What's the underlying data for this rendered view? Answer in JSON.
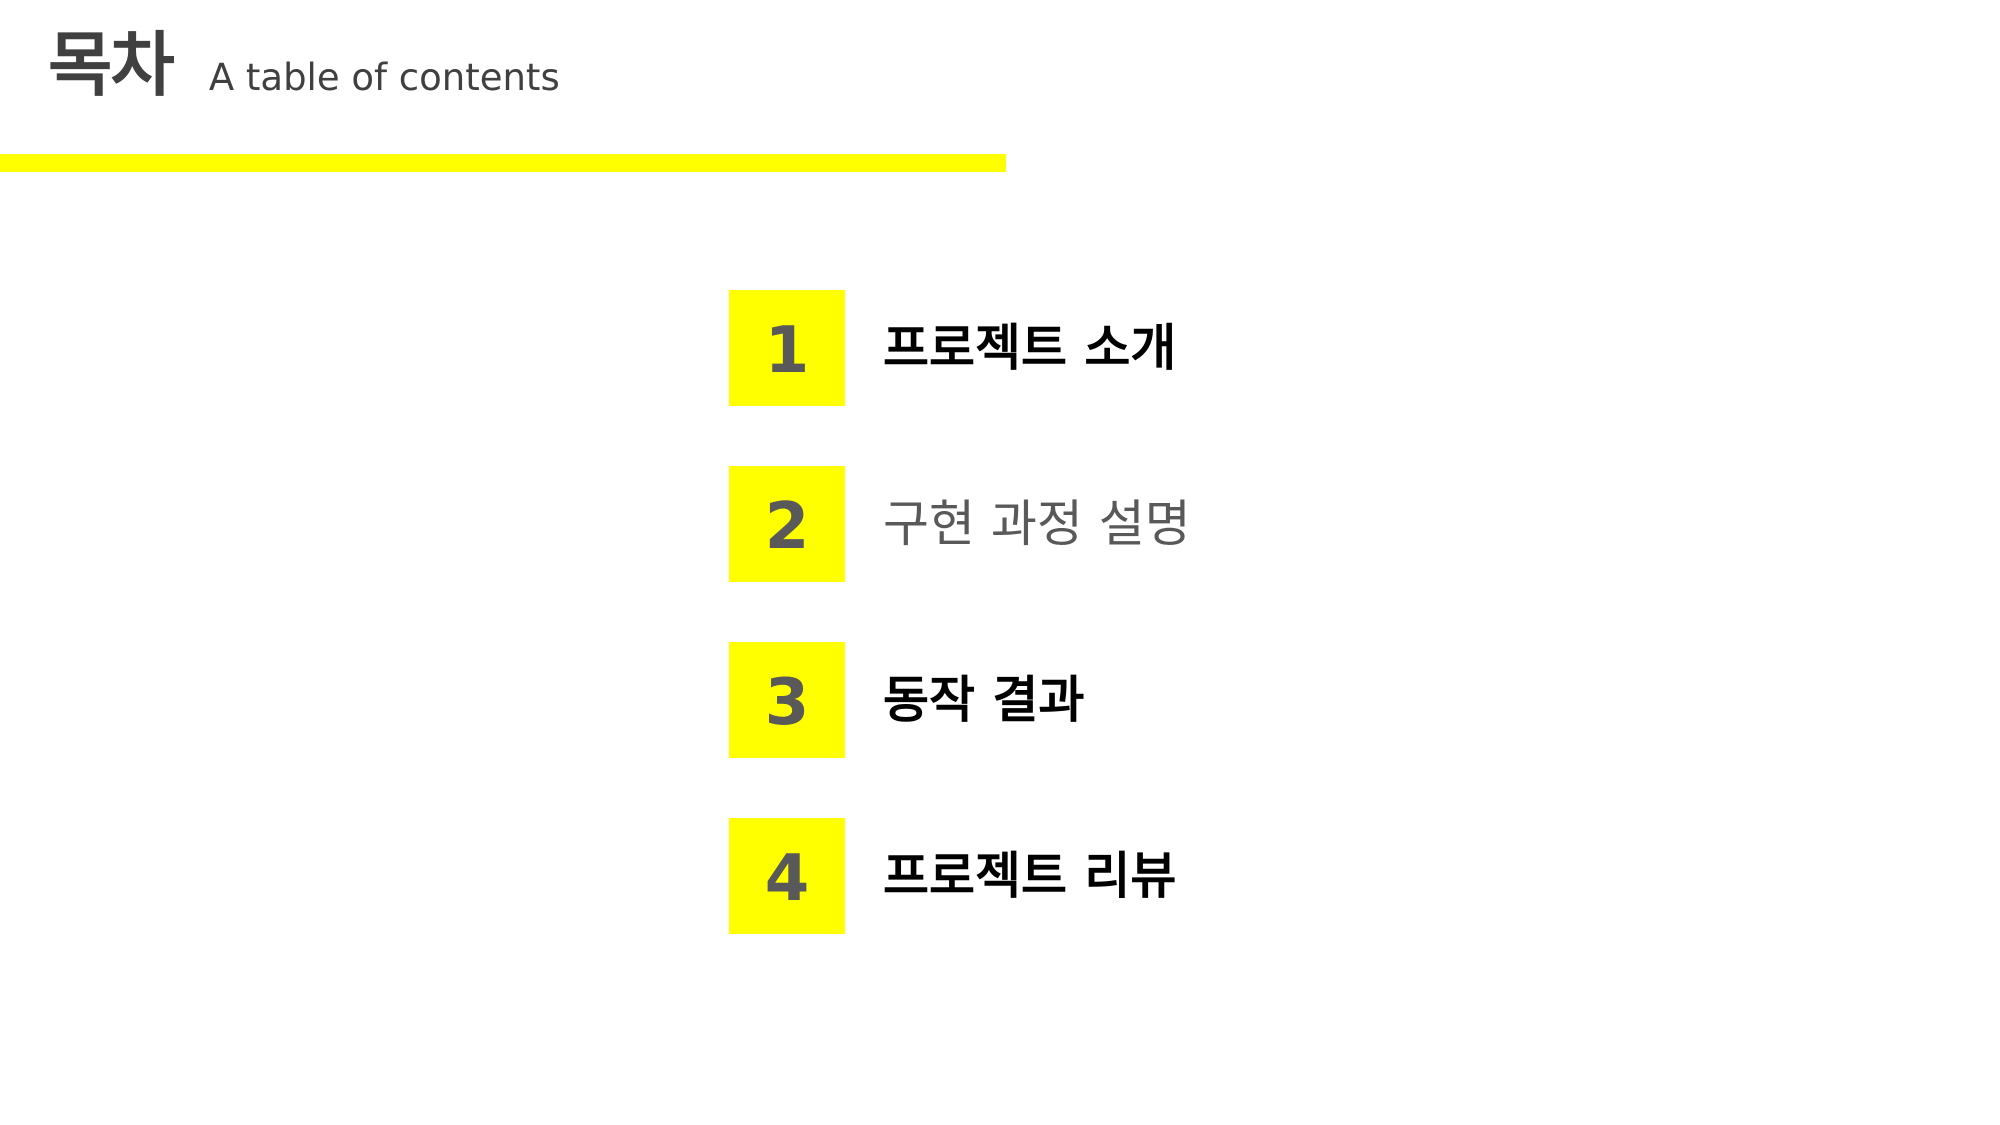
{
  "header": {
    "title": "목차",
    "subtitle": "A table of contents"
  },
  "colors": {
    "accent": "#FFFF00",
    "title_text": "#404040",
    "number_text": "#595959",
    "item_text_dark": "#000000",
    "item_text_gray": "#595959"
  },
  "toc": {
    "items": [
      {
        "number": "1",
        "label": "프로젝트 소개"
      },
      {
        "number": "2",
        "label": "구현 과정 설명"
      },
      {
        "number": "3",
        "label": "동작 결과"
      },
      {
        "number": "4",
        "label": "프로젝트 리뷰"
      }
    ]
  }
}
